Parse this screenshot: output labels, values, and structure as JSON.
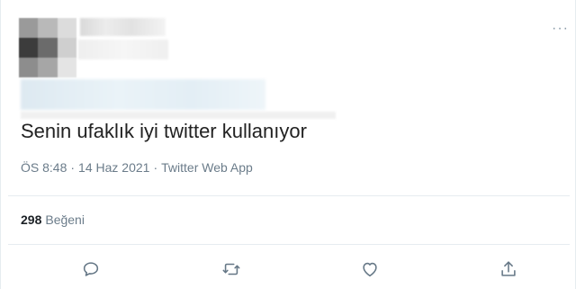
{
  "tweet": {
    "text": "Senin ufaklık iyi twitter kullanıyor",
    "time": "ÖS 8:48",
    "separator": "·",
    "date": "14 Haz 2021",
    "source": "Twitter Web App",
    "likes_count": "298",
    "likes_label": "Beğeni"
  },
  "icons": {
    "more": "more-icon",
    "reply": "reply-icon",
    "retweet": "retweet-icon",
    "like": "heart-icon",
    "share": "share-icon"
  },
  "colors": {
    "icon": "#657786",
    "meta": "#6b7c8a",
    "text": "#222222",
    "divider": "#e6ecf0"
  }
}
